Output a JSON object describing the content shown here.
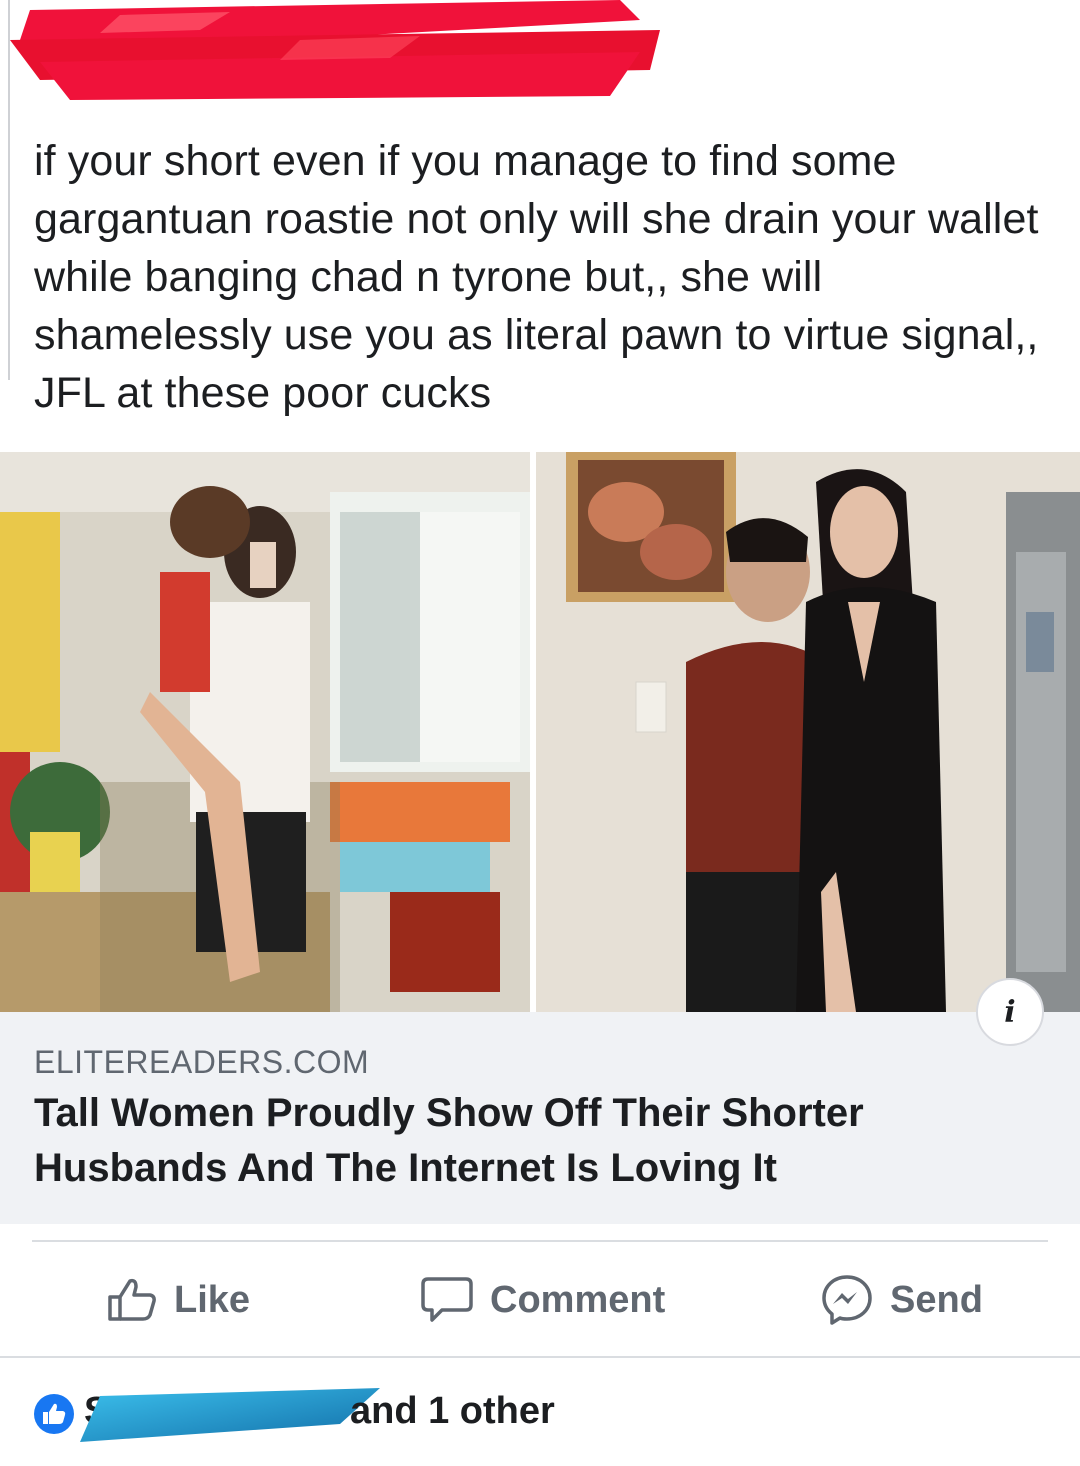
{
  "post": {
    "author_name": "",
    "text": "if your short even if you manage to find some gargantuan roastie not only will she drain your wallet while banging chad n tyrone but,, she will shamelessly use you as literal pawn to virtue signal,, JFL at these poor cucks"
  },
  "link_preview": {
    "domain": "ELITEREADERS.COM",
    "headline": "Tall Women Proudly Show Off Their Shorter Husbands And The Internet Is Loving It",
    "info_icon": "i",
    "images": [
      "tall-woman-kissing-short-man-photo",
      "tall-woman-with-short-man-photo"
    ]
  },
  "actions": {
    "like_label": "Like",
    "comment_label": "Comment",
    "send_label": "Send"
  },
  "reactions": {
    "reactor_initial": "S",
    "summary_text": "and 1 other"
  },
  "colors": {
    "redaction_red": "#f0123a",
    "redaction_blue": "#1ea0d8",
    "like_blue": "#1877f2",
    "action_gray": "#606770",
    "preview_bg": "#f0f2f5"
  }
}
